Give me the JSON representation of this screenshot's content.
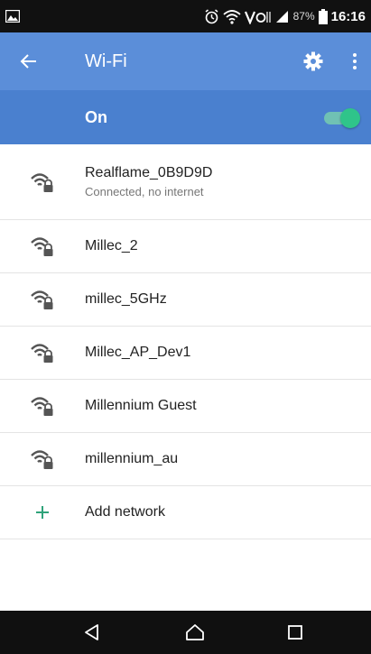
{
  "status_bar": {
    "battery": "87%",
    "time": "16:16",
    "icons": [
      "image-notification-icon",
      "alarm-icon",
      "wifi-icon",
      "volte-icon",
      "signal-icon",
      "battery-icon"
    ]
  },
  "toolbar": {
    "title": "Wi-Fi",
    "icons": [
      "back-arrow-icon",
      "gear-icon",
      "more-vert-icon"
    ]
  },
  "wifi_switch": {
    "label": "On",
    "state": "on"
  },
  "networks": [
    {
      "name": "Realflame_0B9D9D",
      "status": "Connected, no internet"
    },
    {
      "name": "Millec_2"
    },
    {
      "name": "millec_5GHz"
    },
    {
      "name": "Millec_AP_Dev1"
    },
    {
      "name": "Millennium Guest"
    },
    {
      "name": "millennium_au"
    }
  ],
  "add_network": {
    "label": "Add network"
  },
  "colors": {
    "toolbar": "#5b8ed9",
    "switch_bar": "#4a80cf",
    "toggle_accent": "#2fc48a",
    "add_icon": "#2fa37a"
  }
}
